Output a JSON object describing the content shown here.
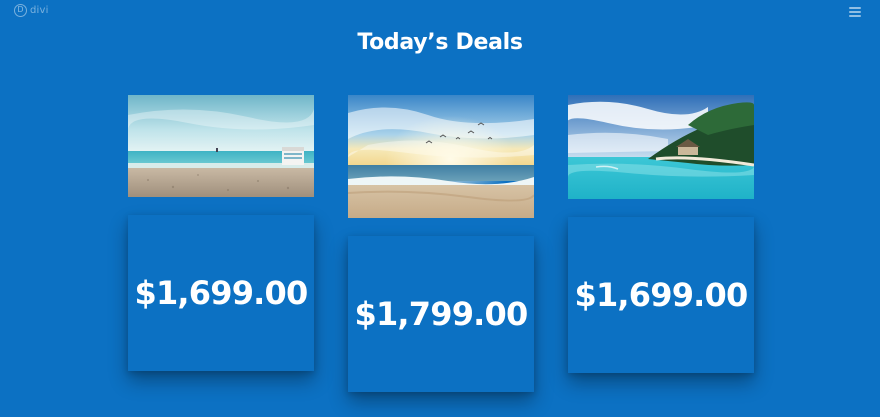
{
  "brand": {
    "logo_letter": "D",
    "name": "divi"
  },
  "header": {
    "menu_icon": "hamburger-menu-icon"
  },
  "title": "Today’s Deals",
  "deals": [
    {
      "image": "beach-with-cabana-photo",
      "price": "$1,699.00"
    },
    {
      "image": "beach-sunset-with-birds-photo",
      "price": "$1,799.00"
    },
    {
      "image": "tropical-island-lagoon-photo",
      "price": "$1,699.00"
    }
  ],
  "colors": {
    "background": "#0c71c3",
    "text": "#ffffff"
  }
}
